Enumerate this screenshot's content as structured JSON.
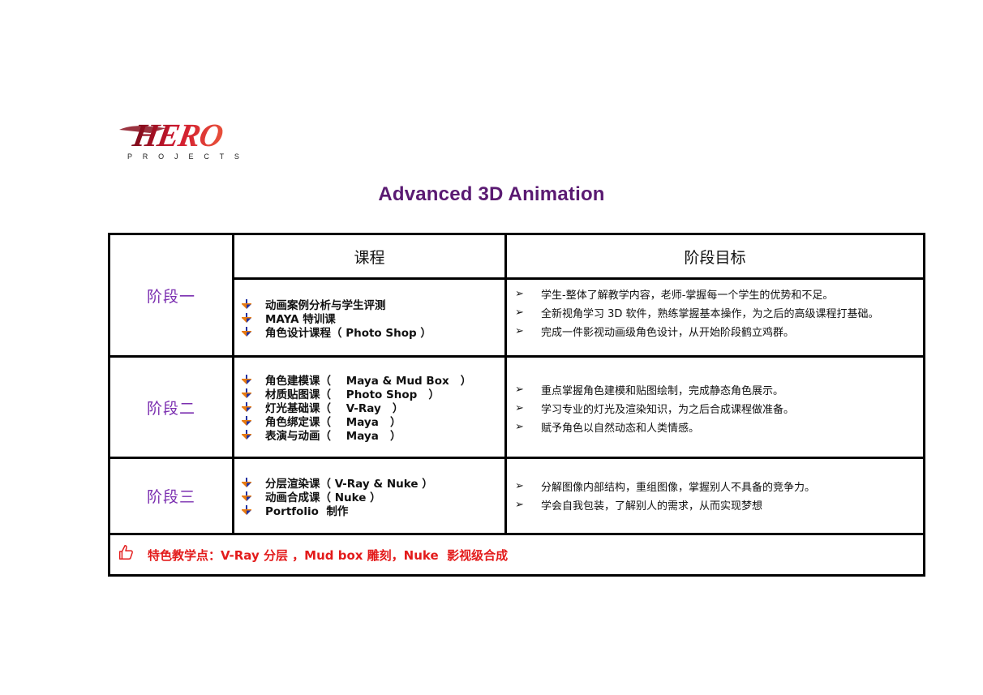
{
  "logo": {
    "word": "HERO",
    "sub": "P R O J E C T S"
  },
  "title": "Advanced 3D Animation",
  "table": {
    "header": {
      "course": "课程",
      "goal": "阶段目标"
    },
    "stages": [
      {
        "label": "阶段一",
        "courses": [
          {
            "name": "动画案例分析与学生评测",
            "tool": ""
          },
          {
            "name": "MAYA 特训课",
            "tool": ""
          },
          {
            "name": "角色设计课程（ Photo Shop ）",
            "tool": ""
          }
        ],
        "goals": [
          "学生-整体了解教学内容，老师-掌握每一个学生的优势和不足。",
          "全新视角学习 3D 软件，熟练掌握基本操作，为之后的高级课程打基础。",
          "完成一件影视动画级角色设计，从开始阶段鹤立鸡群。"
        ]
      },
      {
        "label": "阶段二",
        "courses": [
          {
            "name": "角色建模课",
            "tool": "（    Maya & Mud Box   ）"
          },
          {
            "name": "材质贴图课",
            "tool": "（    Photo Shop   ）"
          },
          {
            "name": "灯光基础课",
            "tool": "（    V-Ray   ）"
          },
          {
            "name": "角色绑定课",
            "tool": "（    Maya   ）"
          },
          {
            "name": "表演与动画",
            "tool": "（    Maya   ）"
          }
        ],
        "goals": [
          "重点掌握角色建模和贴图绘制，完成静态角色展示。",
          "学习专业的灯光及渲染知识，为之后合成课程做准备。",
          "赋予角色以自然动态和人类情感。"
        ]
      },
      {
        "label": "阶段三",
        "courses": [
          {
            "name": "分层渲染课",
            "tool": "（ V-Ray & Nuke ）"
          },
          {
            "name": "动画合成课",
            "tool": "（ Nuke ）"
          },
          {
            "name": "Portfolio  制作",
            "tool": ""
          }
        ],
        "goals": [
          "分解图像内部结构，重组图像，掌握别人不具备的竞争力。",
          "学会自我包装，了解别人的需求，从而实现梦想"
        ]
      }
    ],
    "feature": "特色教学点：V-Ray 分层 ，Mud box 雕刻，Nuke  影视级合成"
  },
  "colors": {
    "title": "#5a1a72",
    "stage_label": "#7b2fb0",
    "feature_text": "#e31b1b",
    "logo_red": "#c8102e",
    "bullet_blue": "#2030a0",
    "bullet_orange": "#e87a10"
  },
  "icons": {
    "course_bullet": "down-arrow-bullet-icon",
    "goal_bullet": "arrowhead-bullet-icon",
    "feature": "thumbs-up-icon"
  }
}
